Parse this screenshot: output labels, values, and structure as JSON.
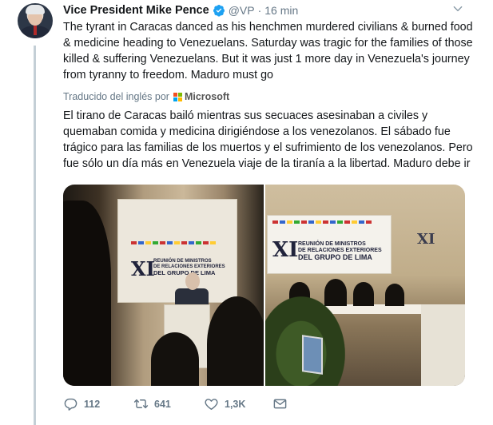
{
  "tweet": {
    "author_name": "Vice President Mike Pence",
    "handle": "@VP",
    "separator": "·",
    "time": "16 min",
    "text": "The tyrant in Caracas danced as his henchmen murdered civilians & burned food & medicine heading to Venezuelans. Saturday was tragic for the families of those killed & suffering Venezuelans. But it was just 1 more day in Venezuela's journey from tyranny to freedom. Maduro must go",
    "translated_label": "Traducido del inglés por",
    "translator": "Microsoft",
    "translation": "El tirano de Caracas bailó mientras sus secuaces asesinaban a civiles y quemaban comida y medicina dirigiéndose a los venezolanos. El sábado fue trágico para las familias de los muertos y el sufrimiento de los venezolanos. Pero fue sólo un día más en Venezuela viaje de la tiranía a la libertad. Maduro debe ir"
  },
  "media": {
    "banner_left": {
      "numeral": "XI",
      "line1": "REUNIÓN DE MINISTROS",
      "line2": "DE RELACIONES EXTERIORES",
      "line3": "DEL GRUPO DE LIMA"
    },
    "banner_right": {
      "numeral": "XI",
      "line1": "REUNIÓN DE MINISTROS",
      "line2": "DE RELACIONES EXTERIORES",
      "line3": "DEL GRUPO DE LIMA"
    },
    "banner_right_small": {
      "numeral": "XI"
    }
  },
  "actions": {
    "replies": "112",
    "retweets": "641",
    "likes": "1,3K"
  },
  "colors": {
    "accent": "#1da1f2",
    "muted": "#657786",
    "thread_line": "#c4cfd6",
    "ms_red": "#f25022",
    "ms_green": "#7fba00",
    "ms_blue": "#00a4ef",
    "ms_yellow": "#ffb900"
  },
  "icons": {
    "verified": "verified-badge-icon",
    "more": "chevron-down-icon",
    "reply": "reply-icon",
    "retweet": "retweet-icon",
    "like": "heart-icon",
    "share": "envelope-icon"
  }
}
